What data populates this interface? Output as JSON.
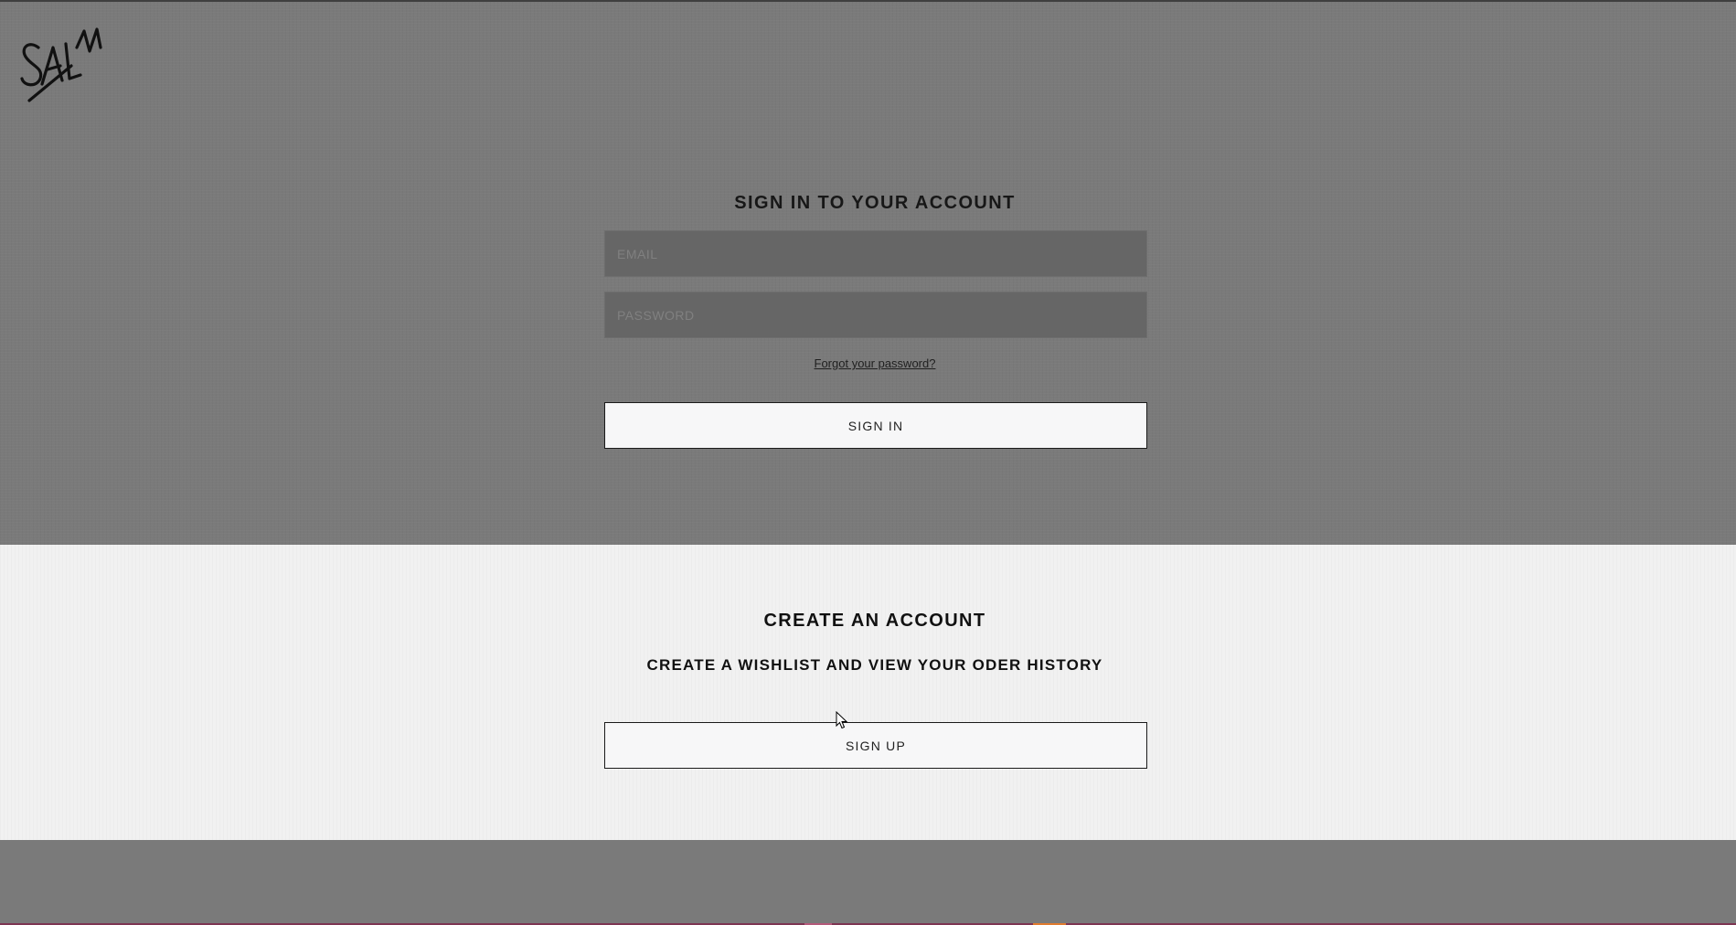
{
  "brand": {
    "logo_text": "SALM"
  },
  "signin": {
    "title": "SIGN IN TO YOUR ACCOUNT",
    "email_placeholder": "EMAIL",
    "password_placeholder": "PASSWORD",
    "forgot_link": "Forgot your password?",
    "button_label": "SIGN IN"
  },
  "signup": {
    "title": "CREATE AN ACCOUNT",
    "subtitle": "CREATE A WISHLIST AND VIEW YOUR ODER HISTORY",
    "button_label": "SIGN UP"
  }
}
